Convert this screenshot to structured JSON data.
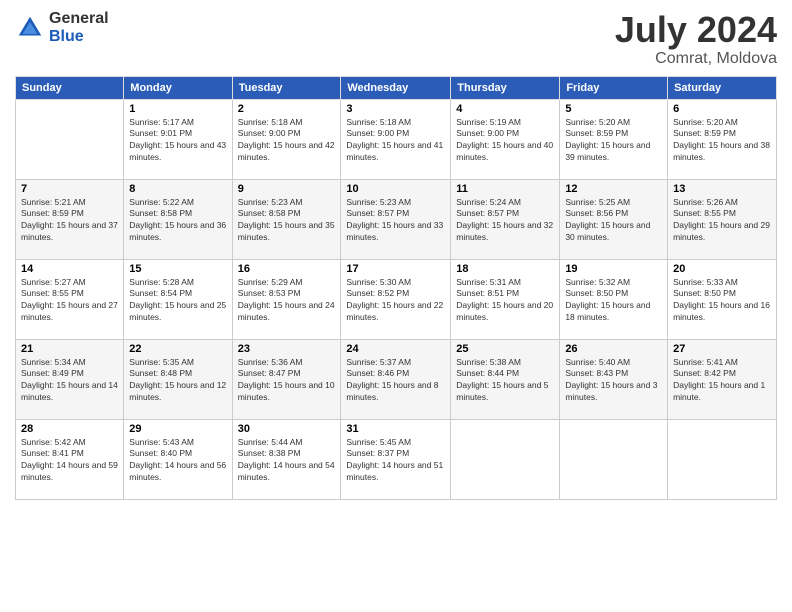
{
  "logo": {
    "general": "General",
    "blue": "Blue"
  },
  "header": {
    "month": "July 2024",
    "location": "Comrat, Moldova"
  },
  "weekdays": [
    "Sunday",
    "Monday",
    "Tuesday",
    "Wednesday",
    "Thursday",
    "Friday",
    "Saturday"
  ],
  "weeks": [
    [
      {
        "day": "",
        "sunrise": "",
        "sunset": "",
        "daylight": ""
      },
      {
        "day": "1",
        "sunrise": "Sunrise: 5:17 AM",
        "sunset": "Sunset: 9:01 PM",
        "daylight": "Daylight: 15 hours and 43 minutes."
      },
      {
        "day": "2",
        "sunrise": "Sunrise: 5:18 AM",
        "sunset": "Sunset: 9:00 PM",
        "daylight": "Daylight: 15 hours and 42 minutes."
      },
      {
        "day": "3",
        "sunrise": "Sunrise: 5:18 AM",
        "sunset": "Sunset: 9:00 PM",
        "daylight": "Daylight: 15 hours and 41 minutes."
      },
      {
        "day": "4",
        "sunrise": "Sunrise: 5:19 AM",
        "sunset": "Sunset: 9:00 PM",
        "daylight": "Daylight: 15 hours and 40 minutes."
      },
      {
        "day": "5",
        "sunrise": "Sunrise: 5:20 AM",
        "sunset": "Sunset: 8:59 PM",
        "daylight": "Daylight: 15 hours and 39 minutes."
      },
      {
        "day": "6",
        "sunrise": "Sunrise: 5:20 AM",
        "sunset": "Sunset: 8:59 PM",
        "daylight": "Daylight: 15 hours and 38 minutes."
      }
    ],
    [
      {
        "day": "7",
        "sunrise": "Sunrise: 5:21 AM",
        "sunset": "Sunset: 8:59 PM",
        "daylight": "Daylight: 15 hours and 37 minutes."
      },
      {
        "day": "8",
        "sunrise": "Sunrise: 5:22 AM",
        "sunset": "Sunset: 8:58 PM",
        "daylight": "Daylight: 15 hours and 36 minutes."
      },
      {
        "day": "9",
        "sunrise": "Sunrise: 5:23 AM",
        "sunset": "Sunset: 8:58 PM",
        "daylight": "Daylight: 15 hours and 35 minutes."
      },
      {
        "day": "10",
        "sunrise": "Sunrise: 5:23 AM",
        "sunset": "Sunset: 8:57 PM",
        "daylight": "Daylight: 15 hours and 33 minutes."
      },
      {
        "day": "11",
        "sunrise": "Sunrise: 5:24 AM",
        "sunset": "Sunset: 8:57 PM",
        "daylight": "Daylight: 15 hours and 32 minutes."
      },
      {
        "day": "12",
        "sunrise": "Sunrise: 5:25 AM",
        "sunset": "Sunset: 8:56 PM",
        "daylight": "Daylight: 15 hours and 30 minutes."
      },
      {
        "day": "13",
        "sunrise": "Sunrise: 5:26 AM",
        "sunset": "Sunset: 8:55 PM",
        "daylight": "Daylight: 15 hours and 29 minutes."
      }
    ],
    [
      {
        "day": "14",
        "sunrise": "Sunrise: 5:27 AM",
        "sunset": "Sunset: 8:55 PM",
        "daylight": "Daylight: 15 hours and 27 minutes."
      },
      {
        "day": "15",
        "sunrise": "Sunrise: 5:28 AM",
        "sunset": "Sunset: 8:54 PM",
        "daylight": "Daylight: 15 hours and 25 minutes."
      },
      {
        "day": "16",
        "sunrise": "Sunrise: 5:29 AM",
        "sunset": "Sunset: 8:53 PM",
        "daylight": "Daylight: 15 hours and 24 minutes."
      },
      {
        "day": "17",
        "sunrise": "Sunrise: 5:30 AM",
        "sunset": "Sunset: 8:52 PM",
        "daylight": "Daylight: 15 hours and 22 minutes."
      },
      {
        "day": "18",
        "sunrise": "Sunrise: 5:31 AM",
        "sunset": "Sunset: 8:51 PM",
        "daylight": "Daylight: 15 hours and 20 minutes."
      },
      {
        "day": "19",
        "sunrise": "Sunrise: 5:32 AM",
        "sunset": "Sunset: 8:50 PM",
        "daylight": "Daylight: 15 hours and 18 minutes."
      },
      {
        "day": "20",
        "sunrise": "Sunrise: 5:33 AM",
        "sunset": "Sunset: 8:50 PM",
        "daylight": "Daylight: 15 hours and 16 minutes."
      }
    ],
    [
      {
        "day": "21",
        "sunrise": "Sunrise: 5:34 AM",
        "sunset": "Sunset: 8:49 PM",
        "daylight": "Daylight: 15 hours and 14 minutes."
      },
      {
        "day": "22",
        "sunrise": "Sunrise: 5:35 AM",
        "sunset": "Sunset: 8:48 PM",
        "daylight": "Daylight: 15 hours and 12 minutes."
      },
      {
        "day": "23",
        "sunrise": "Sunrise: 5:36 AM",
        "sunset": "Sunset: 8:47 PM",
        "daylight": "Daylight: 15 hours and 10 minutes."
      },
      {
        "day": "24",
        "sunrise": "Sunrise: 5:37 AM",
        "sunset": "Sunset: 8:46 PM",
        "daylight": "Daylight: 15 hours and 8 minutes."
      },
      {
        "day": "25",
        "sunrise": "Sunrise: 5:38 AM",
        "sunset": "Sunset: 8:44 PM",
        "daylight": "Daylight: 15 hours and 5 minutes."
      },
      {
        "day": "26",
        "sunrise": "Sunrise: 5:40 AM",
        "sunset": "Sunset: 8:43 PM",
        "daylight": "Daylight: 15 hours and 3 minutes."
      },
      {
        "day": "27",
        "sunrise": "Sunrise: 5:41 AM",
        "sunset": "Sunset: 8:42 PM",
        "daylight": "Daylight: 15 hours and 1 minute."
      }
    ],
    [
      {
        "day": "28",
        "sunrise": "Sunrise: 5:42 AM",
        "sunset": "Sunset: 8:41 PM",
        "daylight": "Daylight: 14 hours and 59 minutes."
      },
      {
        "day": "29",
        "sunrise": "Sunrise: 5:43 AM",
        "sunset": "Sunset: 8:40 PM",
        "daylight": "Daylight: 14 hours and 56 minutes."
      },
      {
        "day": "30",
        "sunrise": "Sunrise: 5:44 AM",
        "sunset": "Sunset: 8:38 PM",
        "daylight": "Daylight: 14 hours and 54 minutes."
      },
      {
        "day": "31",
        "sunrise": "Sunrise: 5:45 AM",
        "sunset": "Sunset: 8:37 PM",
        "daylight": "Daylight: 14 hours and 51 minutes."
      },
      {
        "day": "",
        "sunrise": "",
        "sunset": "",
        "daylight": ""
      },
      {
        "day": "",
        "sunrise": "",
        "sunset": "",
        "daylight": ""
      },
      {
        "day": "",
        "sunrise": "",
        "sunset": "",
        "daylight": ""
      }
    ]
  ]
}
